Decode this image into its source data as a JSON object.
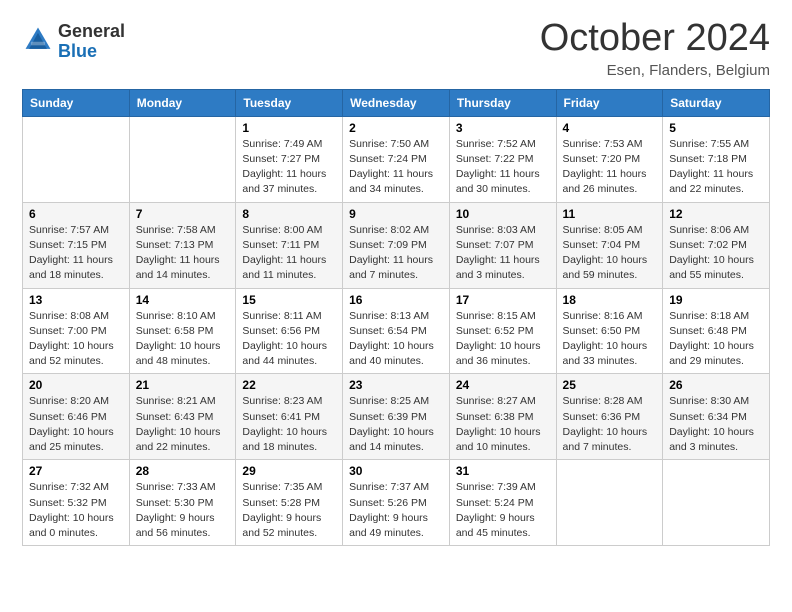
{
  "header": {
    "logo_general": "General",
    "logo_blue": "Blue",
    "month": "October 2024",
    "location": "Esen, Flanders, Belgium"
  },
  "weekdays": [
    "Sunday",
    "Monday",
    "Tuesday",
    "Wednesday",
    "Thursday",
    "Friday",
    "Saturday"
  ],
  "weeks": [
    [
      {
        "day": "",
        "sunrise": "",
        "sunset": "",
        "daylight": ""
      },
      {
        "day": "",
        "sunrise": "",
        "sunset": "",
        "daylight": ""
      },
      {
        "day": "1",
        "sunrise": "Sunrise: 7:49 AM",
        "sunset": "Sunset: 7:27 PM",
        "daylight": "Daylight: 11 hours and 37 minutes."
      },
      {
        "day": "2",
        "sunrise": "Sunrise: 7:50 AM",
        "sunset": "Sunset: 7:24 PM",
        "daylight": "Daylight: 11 hours and 34 minutes."
      },
      {
        "day": "3",
        "sunrise": "Sunrise: 7:52 AM",
        "sunset": "Sunset: 7:22 PM",
        "daylight": "Daylight: 11 hours and 30 minutes."
      },
      {
        "day": "4",
        "sunrise": "Sunrise: 7:53 AM",
        "sunset": "Sunset: 7:20 PM",
        "daylight": "Daylight: 11 hours and 26 minutes."
      },
      {
        "day": "5",
        "sunrise": "Sunrise: 7:55 AM",
        "sunset": "Sunset: 7:18 PM",
        "daylight": "Daylight: 11 hours and 22 minutes."
      }
    ],
    [
      {
        "day": "6",
        "sunrise": "Sunrise: 7:57 AM",
        "sunset": "Sunset: 7:15 PM",
        "daylight": "Daylight: 11 hours and 18 minutes."
      },
      {
        "day": "7",
        "sunrise": "Sunrise: 7:58 AM",
        "sunset": "Sunset: 7:13 PM",
        "daylight": "Daylight: 11 hours and 14 minutes."
      },
      {
        "day": "8",
        "sunrise": "Sunrise: 8:00 AM",
        "sunset": "Sunset: 7:11 PM",
        "daylight": "Daylight: 11 hours and 11 minutes."
      },
      {
        "day": "9",
        "sunrise": "Sunrise: 8:02 AM",
        "sunset": "Sunset: 7:09 PM",
        "daylight": "Daylight: 11 hours and 7 minutes."
      },
      {
        "day": "10",
        "sunrise": "Sunrise: 8:03 AM",
        "sunset": "Sunset: 7:07 PM",
        "daylight": "Daylight: 11 hours and 3 minutes."
      },
      {
        "day": "11",
        "sunrise": "Sunrise: 8:05 AM",
        "sunset": "Sunset: 7:04 PM",
        "daylight": "Daylight: 10 hours and 59 minutes."
      },
      {
        "day": "12",
        "sunrise": "Sunrise: 8:06 AM",
        "sunset": "Sunset: 7:02 PM",
        "daylight": "Daylight: 10 hours and 55 minutes."
      }
    ],
    [
      {
        "day": "13",
        "sunrise": "Sunrise: 8:08 AM",
        "sunset": "Sunset: 7:00 PM",
        "daylight": "Daylight: 10 hours and 52 minutes."
      },
      {
        "day": "14",
        "sunrise": "Sunrise: 8:10 AM",
        "sunset": "Sunset: 6:58 PM",
        "daylight": "Daylight: 10 hours and 48 minutes."
      },
      {
        "day": "15",
        "sunrise": "Sunrise: 8:11 AM",
        "sunset": "Sunset: 6:56 PM",
        "daylight": "Daylight: 10 hours and 44 minutes."
      },
      {
        "day": "16",
        "sunrise": "Sunrise: 8:13 AM",
        "sunset": "Sunset: 6:54 PM",
        "daylight": "Daylight: 10 hours and 40 minutes."
      },
      {
        "day": "17",
        "sunrise": "Sunrise: 8:15 AM",
        "sunset": "Sunset: 6:52 PM",
        "daylight": "Daylight: 10 hours and 36 minutes."
      },
      {
        "day": "18",
        "sunrise": "Sunrise: 8:16 AM",
        "sunset": "Sunset: 6:50 PM",
        "daylight": "Daylight: 10 hours and 33 minutes."
      },
      {
        "day": "19",
        "sunrise": "Sunrise: 8:18 AM",
        "sunset": "Sunset: 6:48 PM",
        "daylight": "Daylight: 10 hours and 29 minutes."
      }
    ],
    [
      {
        "day": "20",
        "sunrise": "Sunrise: 8:20 AM",
        "sunset": "Sunset: 6:46 PM",
        "daylight": "Daylight: 10 hours and 25 minutes."
      },
      {
        "day": "21",
        "sunrise": "Sunrise: 8:21 AM",
        "sunset": "Sunset: 6:43 PM",
        "daylight": "Daylight: 10 hours and 22 minutes."
      },
      {
        "day": "22",
        "sunrise": "Sunrise: 8:23 AM",
        "sunset": "Sunset: 6:41 PM",
        "daylight": "Daylight: 10 hours and 18 minutes."
      },
      {
        "day": "23",
        "sunrise": "Sunrise: 8:25 AM",
        "sunset": "Sunset: 6:39 PM",
        "daylight": "Daylight: 10 hours and 14 minutes."
      },
      {
        "day": "24",
        "sunrise": "Sunrise: 8:27 AM",
        "sunset": "Sunset: 6:38 PM",
        "daylight": "Daylight: 10 hours and 10 minutes."
      },
      {
        "day": "25",
        "sunrise": "Sunrise: 8:28 AM",
        "sunset": "Sunset: 6:36 PM",
        "daylight": "Daylight: 10 hours and 7 minutes."
      },
      {
        "day": "26",
        "sunrise": "Sunrise: 8:30 AM",
        "sunset": "Sunset: 6:34 PM",
        "daylight": "Daylight: 10 hours and 3 minutes."
      }
    ],
    [
      {
        "day": "27",
        "sunrise": "Sunrise: 7:32 AM",
        "sunset": "Sunset: 5:32 PM",
        "daylight": "Daylight: 10 hours and 0 minutes."
      },
      {
        "day": "28",
        "sunrise": "Sunrise: 7:33 AM",
        "sunset": "Sunset: 5:30 PM",
        "daylight": "Daylight: 9 hours and 56 minutes."
      },
      {
        "day": "29",
        "sunrise": "Sunrise: 7:35 AM",
        "sunset": "Sunset: 5:28 PM",
        "daylight": "Daylight: 9 hours and 52 minutes."
      },
      {
        "day": "30",
        "sunrise": "Sunrise: 7:37 AM",
        "sunset": "Sunset: 5:26 PM",
        "daylight": "Daylight: 9 hours and 49 minutes."
      },
      {
        "day": "31",
        "sunrise": "Sunrise: 7:39 AM",
        "sunset": "Sunset: 5:24 PM",
        "daylight": "Daylight: 9 hours and 45 minutes."
      },
      {
        "day": "",
        "sunrise": "",
        "sunset": "",
        "daylight": ""
      },
      {
        "day": "",
        "sunrise": "",
        "sunset": "",
        "daylight": ""
      }
    ]
  ]
}
